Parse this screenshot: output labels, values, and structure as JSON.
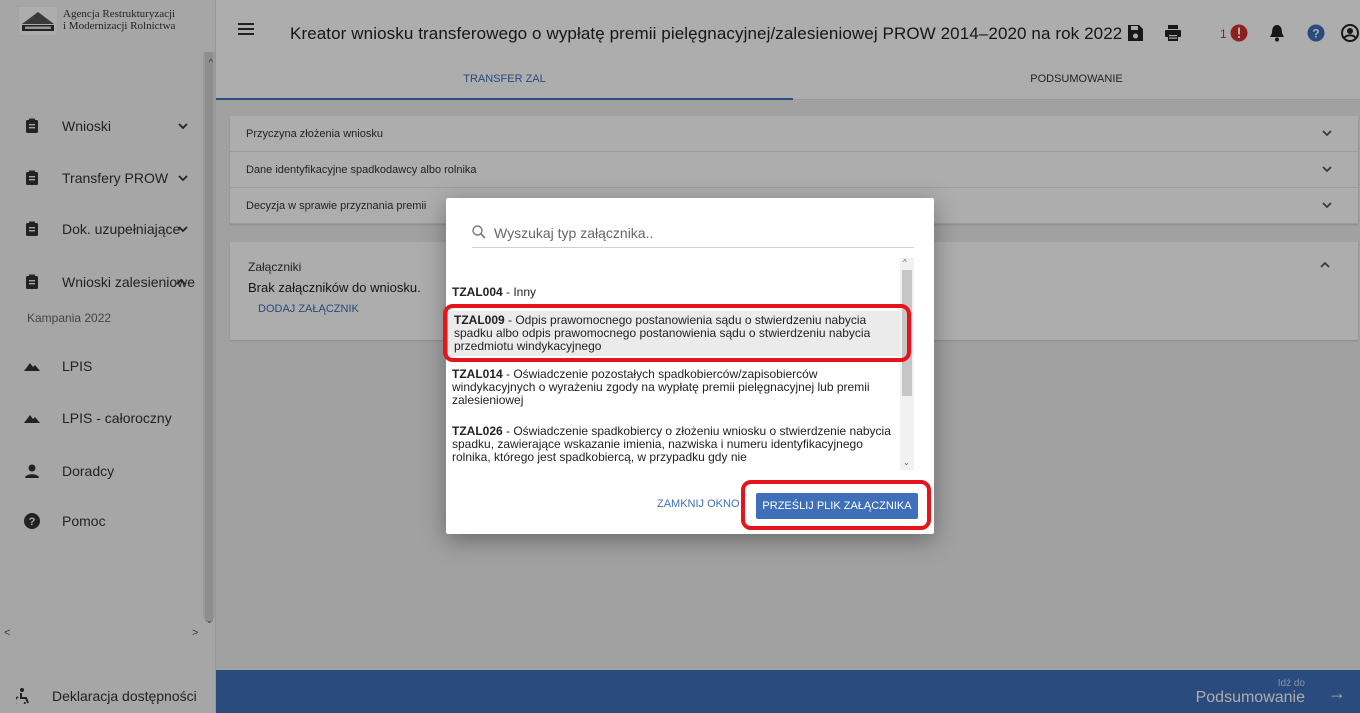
{
  "logo": {
    "line1": "Agencja Restrukturyzacji",
    "line2": "i Modernizacji Rolnictwa"
  },
  "sidebar": {
    "items": [
      {
        "label": "Wnioski",
        "icon": "clipboard-icon",
        "chevron": "⌄"
      },
      {
        "label": "Transfery PROW",
        "icon": "clipboard-icon",
        "chevron": "⌄"
      },
      {
        "label": "Dok. uzupełniające",
        "icon": "clipboard-icon",
        "chevron": "⌄"
      },
      {
        "label": "Wnioski zalesieniowe",
        "icon": "clipboard-icon",
        "chevron": "^"
      },
      {
        "label": "LPIS",
        "icon": "mountain-icon"
      },
      {
        "label": "LPIS - całoroczny",
        "icon": "mountain-icon"
      },
      {
        "label": "Doradcy",
        "icon": "person-icon"
      },
      {
        "label": "Pomoc",
        "icon": "help-icon"
      }
    ],
    "campaign": "Kampania 2022",
    "declaration": "Deklaracja dostępności"
  },
  "header": {
    "title": "Kreator wniosku transferowego o wypłatę premii pielęgnacyjnej/zalesieniowej PROW 2014–2020 na rok 2022",
    "notification_count": "1"
  },
  "tabs": [
    {
      "label": "TRANSFER ZAL",
      "active": true
    },
    {
      "label": "PODSUMOWANIE",
      "active": false
    }
  ],
  "panels": {
    "rows": [
      "Przyczyna złożenia wniosku",
      "Dane identyfikacyjne spadkodawcy albo rolnika",
      "Decyzja w sprawie przyznania premii"
    ],
    "attachments": {
      "title": "Załączniki",
      "empty": "Brak załączników do wniosku.",
      "add": "DODAJ ZAŁĄCZNIK"
    }
  },
  "bottom": {
    "goto_small": "Idź do",
    "goto_big": "Podsumowanie"
  },
  "modal": {
    "search_placeholder": "Wyszukaj typ załącznika..",
    "items": [
      {
        "code": "TZAL004",
        "text": " - Inny"
      },
      {
        "code": "TZAL009",
        "text": " - Odpis prawomocnego postanowienia sądu o stwierdzeniu nabycia spadku albo odpis prawomocnego postanowienia sądu o stwierdzeniu nabycia przedmiotu windykacyjnego"
      },
      {
        "code": "TZAL014",
        "text": " - Oświadczenie pozostałych spadkobierców/zapisobierców windykacyjnych o wyrażeniu zgody na wypłatę premii pielęgnacyjnej lub premii zalesieniowej"
      },
      {
        "code": "TZAL026",
        "text": " - Oświadczenie spadkobiercy o złożeniu wniosku o stwierdzenie nabycia spadku, zawierające wskazanie imienia, nazwiska i numeru identyfikacyjnego rolnika, którego jest spadkobiercą, w przypadku gdy nie"
      }
    ],
    "close": "ZAMKNIJ OKNO",
    "upload": "PRZEŚLIJ PLIK ZAŁĄCZNIKA"
  },
  "colors": {
    "accent": "#3e6fb8",
    "highlight": "#e5131a",
    "alert": "#d32f2f"
  }
}
